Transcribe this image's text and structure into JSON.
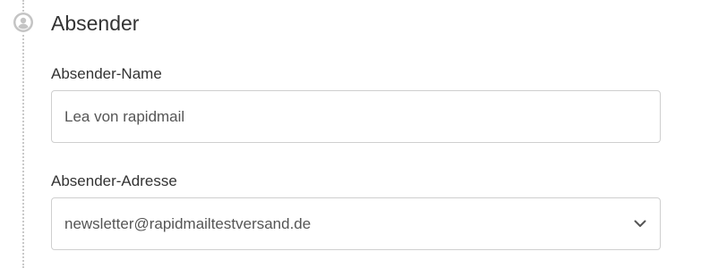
{
  "section": {
    "title": "Absender",
    "icon": "user-circle-icon"
  },
  "fields": {
    "sender_name": {
      "label": "Absender-Name",
      "value": "Lea von rapidmail"
    },
    "sender_address": {
      "label": "Absender-Adresse",
      "selected": "newsletter@rapidmailtestversand.de",
      "icon": "chevron-down-icon"
    }
  },
  "colors": {
    "border": "#cfcfcf",
    "text": "#333333",
    "input_text": "#555555",
    "timeline": "#c9c9c9",
    "icon": "#bdbdbd"
  }
}
